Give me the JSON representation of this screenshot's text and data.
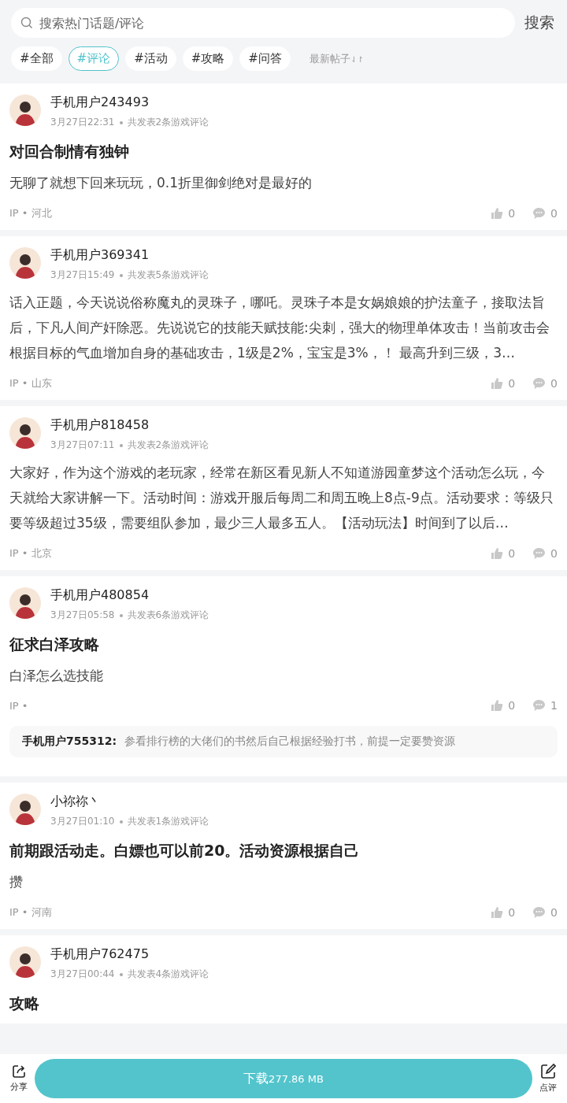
{
  "search": {
    "placeholder": "搜索热门话题/评论",
    "button": "搜索"
  },
  "filters": [
    {
      "label": "#全部",
      "selected": false
    },
    {
      "label": "#评论",
      "selected": true
    },
    {
      "label": "#活动",
      "selected": false
    },
    {
      "label": "#攻略",
      "selected": false
    },
    {
      "label": "#问答",
      "selected": false
    }
  ],
  "sort": {
    "label": "最新帖子",
    "icon": "⇃↾"
  },
  "posts": [
    {
      "user": "手机用户243493",
      "time": "3月27日22:31",
      "info": "共发表2条游戏评论",
      "title": "对回合制情有独钟",
      "body": "无聊了就想下回来玩玩，0.1折里御剑绝对是最好的",
      "ip": "IP • 河北",
      "likes": "0",
      "comments": "0"
    },
    {
      "user": "手机用户369341",
      "time": "3月27日15:49",
      "info": "共发表5条游戏评论",
      "body": "话入正题，今天说说俗称魔丸的灵珠子，哪吒。灵珠子本是女娲娘娘的护法童子，接取法旨后，下凡人间产奸除恶。先说说它的技能天赋技能:尖刺，强大的物理单体攻击！当前攻击会根据目标的气血增加自身的基础攻击，1级是2%，宝宝是3%，！ 最高升到三级，3…",
      "ip": "IP • 山东",
      "likes": "0",
      "comments": "0"
    },
    {
      "user": "手机用户818458",
      "time": "3月27日07:11",
      "info": "共发表2条游戏评论",
      "body": "大家好，作为这个游戏的老玩家，经常在新区看见新人不知道游园童梦这个活动怎么玩，今天就给大家讲解一下。活动时间：游戏开服后每周二和周五晚上8点-9点。活动要求：等级只要等级超过35级，需要组队参加，最少三人最多五人。【活动玩法】时间到了以后…",
      "ip": "IP • 北京",
      "likes": "0",
      "comments": "0"
    },
    {
      "user": "手机用户480854",
      "time": "3月27日05:58",
      "info": "共发表6条游戏评论",
      "title": "征求白泽攻略",
      "body": "白泽怎么选技能",
      "ip": "IP •",
      "likes": "0",
      "comments": "1",
      "reply": {
        "user": "手机用户755312:",
        "text": "参看排行榜的大佬们的书然后自己根据经验打书，前提一定要赞资源"
      }
    },
    {
      "user": "小祢祢丶",
      "time": "3月27日01:10",
      "info": "共发表1条游戏评论",
      "title": "前期跟活动走。白嫖也可以前20。活动资源根据自己",
      "body": "攒",
      "ip": "IP • 河南",
      "likes": "0",
      "comments": "0"
    },
    {
      "user": "手机用户762475",
      "time": "3月27日00:44",
      "info": "共发表4条游戏评论",
      "title": "攻略"
    }
  ],
  "bottom_bar": {
    "share": "分享",
    "download": "下载",
    "size": "277.86 MB",
    "review": "点评"
  }
}
